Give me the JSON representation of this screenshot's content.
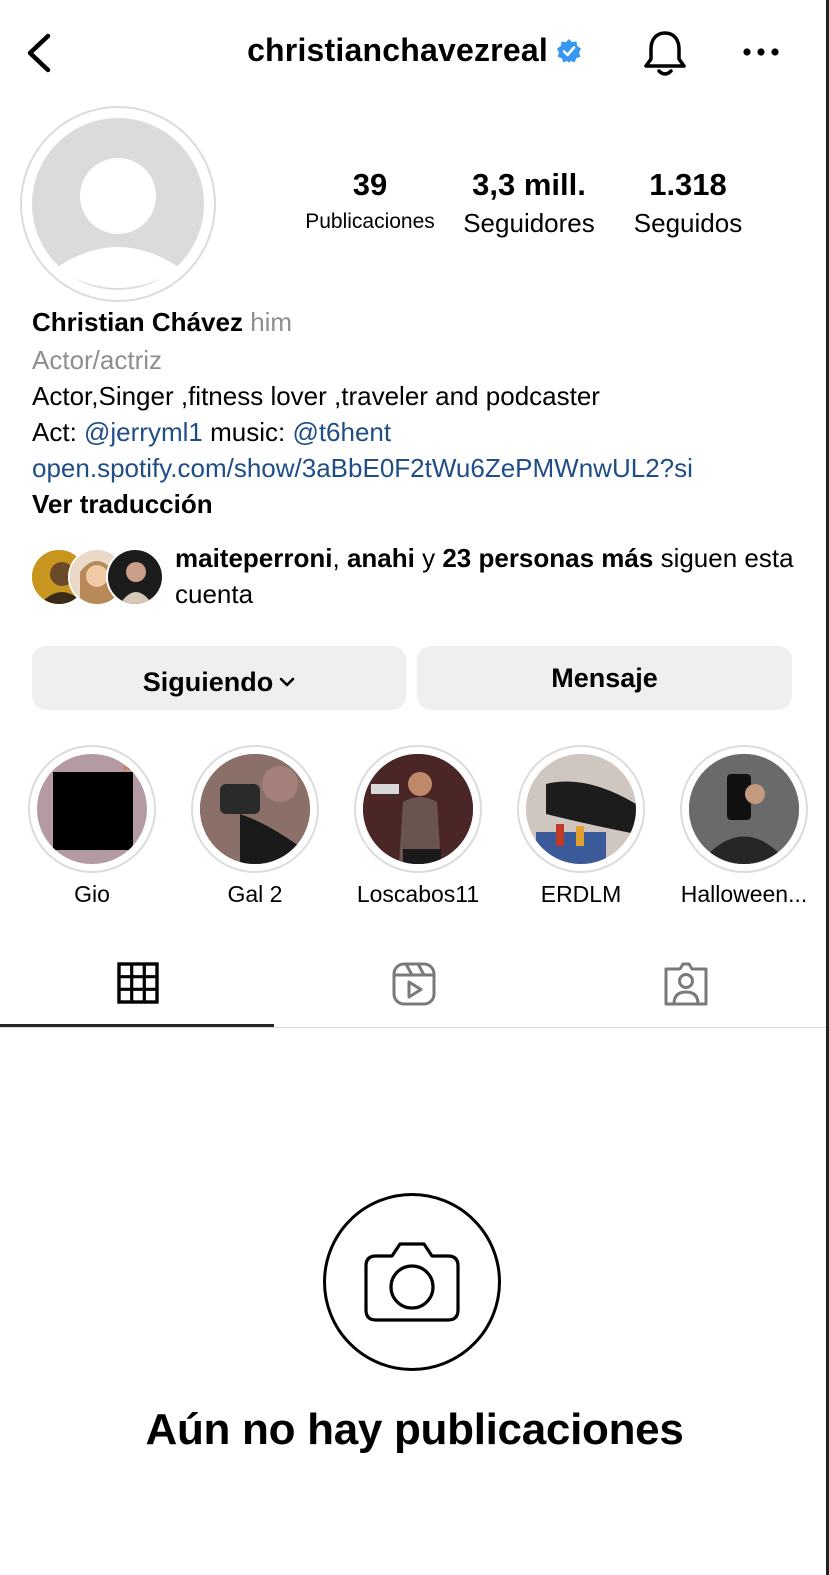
{
  "header": {
    "username": "christianchavezreal",
    "verified": true,
    "icons": [
      "back-arrow-icon",
      "verified-badge-icon",
      "bell-icon",
      "more-options-icon"
    ]
  },
  "stats": {
    "posts": {
      "value": "39",
      "label": "Publicaciones"
    },
    "followers": {
      "value": "3,3 mill.",
      "label": "Seguidores"
    },
    "following": {
      "value": "1.318",
      "label": "Seguidos"
    }
  },
  "bio": {
    "name": "Christian Chávez",
    "pronouns": "him",
    "category": "Actor/actriz",
    "line1": "Actor,Singer ,fitness lover ,traveler and podcaster",
    "act_prefix": "Act: ",
    "act_handle": "@jerryml1",
    "music_prefix": " music: ",
    "music_handle": "@t6hent",
    "link": "open.spotify.com/show/3aBbE0F2tWu6ZePMWnwUL2?si",
    "translate": "Ver traducción"
  },
  "followed_by": {
    "user1": "maiteperroni",
    "sep1": ", ",
    "user2": "anahi",
    "sep2": " y ",
    "others": "23 personas más",
    "suffix": " siguen esta cuenta"
  },
  "buttons": {
    "following": "Siguiendo",
    "message": "Mensaje"
  },
  "highlights": [
    {
      "label": "Gio"
    },
    {
      "label": "Gal 2"
    },
    {
      "label": "Loscabos11"
    },
    {
      "label": "ERDLM"
    },
    {
      "label": "Halloween..."
    }
  ],
  "tabs": [
    "grid-icon",
    "reels-icon",
    "tagged-icon"
  ],
  "empty_state": {
    "title": "Aún no hay publicaciones",
    "icon": "camera-icon"
  },
  "colors": {
    "link": "#1f4e87",
    "verified": "#3897f0",
    "secondary_text": "#8e8e8e",
    "button_bg": "#efefef"
  }
}
